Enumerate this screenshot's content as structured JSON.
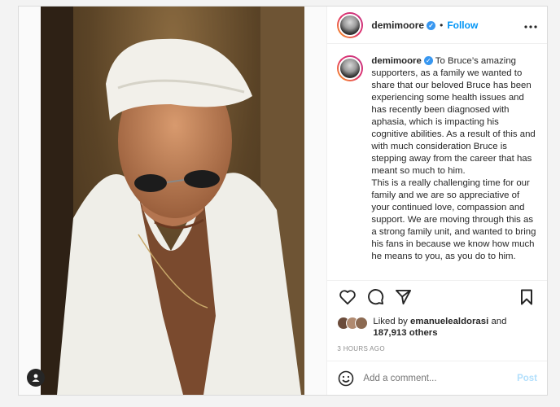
{
  "post": {
    "username": "demimoore",
    "verified_badge": "✓",
    "dot": "•",
    "follow_label": "Follow",
    "more_label": "•••",
    "caption_p1": "To Bruce’s amazing supporters, as a family we wanted to share that our beloved Bruce has been experiencing some health issues and has recently been diagnosed with aphasia, which is impacting his cognitive abilities. As a result of this and with much consideration Bruce is stepping away from the career that has meant so much to him.",
    "caption_p2": "This is a really challenging time for our family and we are so appreciative of your continued love, compassion and support. We are moving through this as a strong family unit, and wanted to bring his fans in because we know how much he means to you, as you do to him.",
    "liked_by_prefix": "Liked by",
    "liked_by_user": "emanuelealdorasi",
    "liked_by_and": "and",
    "others_count": "187,913 others",
    "time_ago": "3 HOURS AGO",
    "comment_placeholder": "Add a comment...",
    "post_label": "Post"
  },
  "icons": [
    "heart-icon",
    "comment-icon",
    "share-icon",
    "bookmark-icon",
    "emoji-icon",
    "user-tag-icon",
    "more-options-icon"
  ],
  "colors": {
    "accent": "#0095f6",
    "verified": "#3897f0",
    "post_disabled": "#b2dffc",
    "muted": "#8e8e8e"
  }
}
